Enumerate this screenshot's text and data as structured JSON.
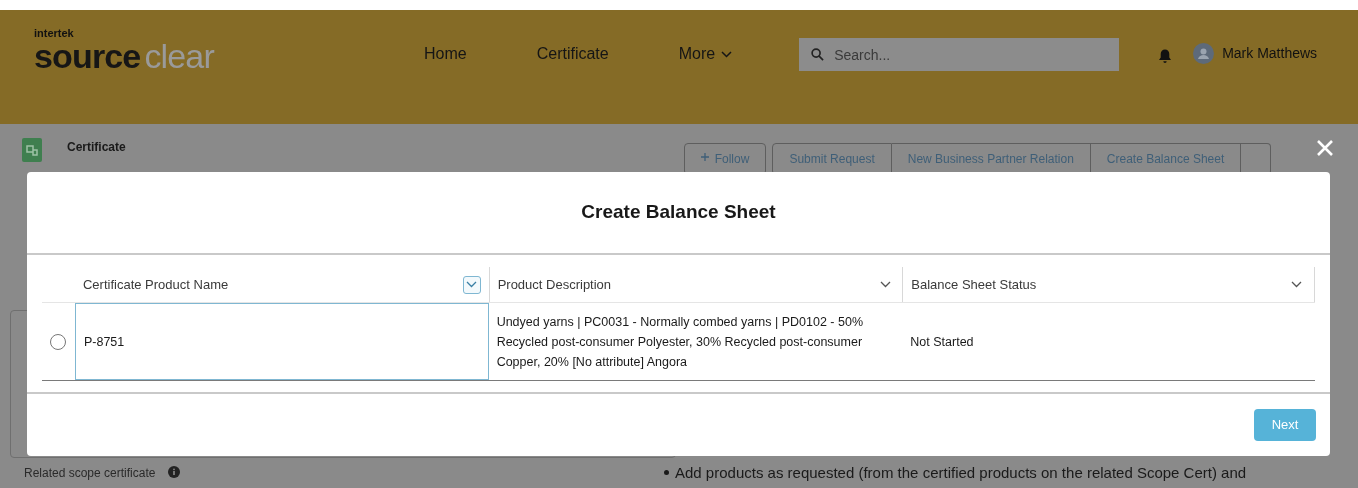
{
  "header": {
    "logo_small": "intertek",
    "logo_main": "source",
    "logo_accent": "clear",
    "nav": [
      {
        "label": "Home",
        "kind": "link"
      },
      {
        "label": "Certificate",
        "kind": "link"
      },
      {
        "label": "More",
        "kind": "menu"
      }
    ],
    "search": {
      "placeholder": "Search..."
    },
    "user": "Mark Matthews"
  },
  "record": {
    "object": "Certificate",
    "actions": [
      {
        "label": "Follow",
        "kind": "follow"
      },
      {
        "label": "Submit Request",
        "kind": "plain"
      },
      {
        "label": "New Business Partner Relation",
        "kind": "plain"
      },
      {
        "label": "Create Balance Sheet",
        "kind": "plain"
      }
    ]
  },
  "background": {
    "field_label": "Related scope certificate",
    "bullet": "Add products as requested (from the certified products on the related Scope Cert) and"
  },
  "modal": {
    "title": "Create Balance Sheet",
    "columns": [
      {
        "label": "Certificate Product Name",
        "focused": true
      },
      {
        "label": "Product Description",
        "focused": false
      },
      {
        "label": "Balance Sheet Status",
        "focused": false
      }
    ],
    "rows": [
      {
        "selected": false,
        "cells": [
          "P-8751",
          "Undyed yarns | PC0031 - Normally combed yarns | PD0102 - 50% Recycled post-consumer Polyester, 30% Recycled post-consumer Copper, 20% [No attribute] Angora",
          "Not Started"
        ]
      }
    ],
    "button": "Next"
  }
}
